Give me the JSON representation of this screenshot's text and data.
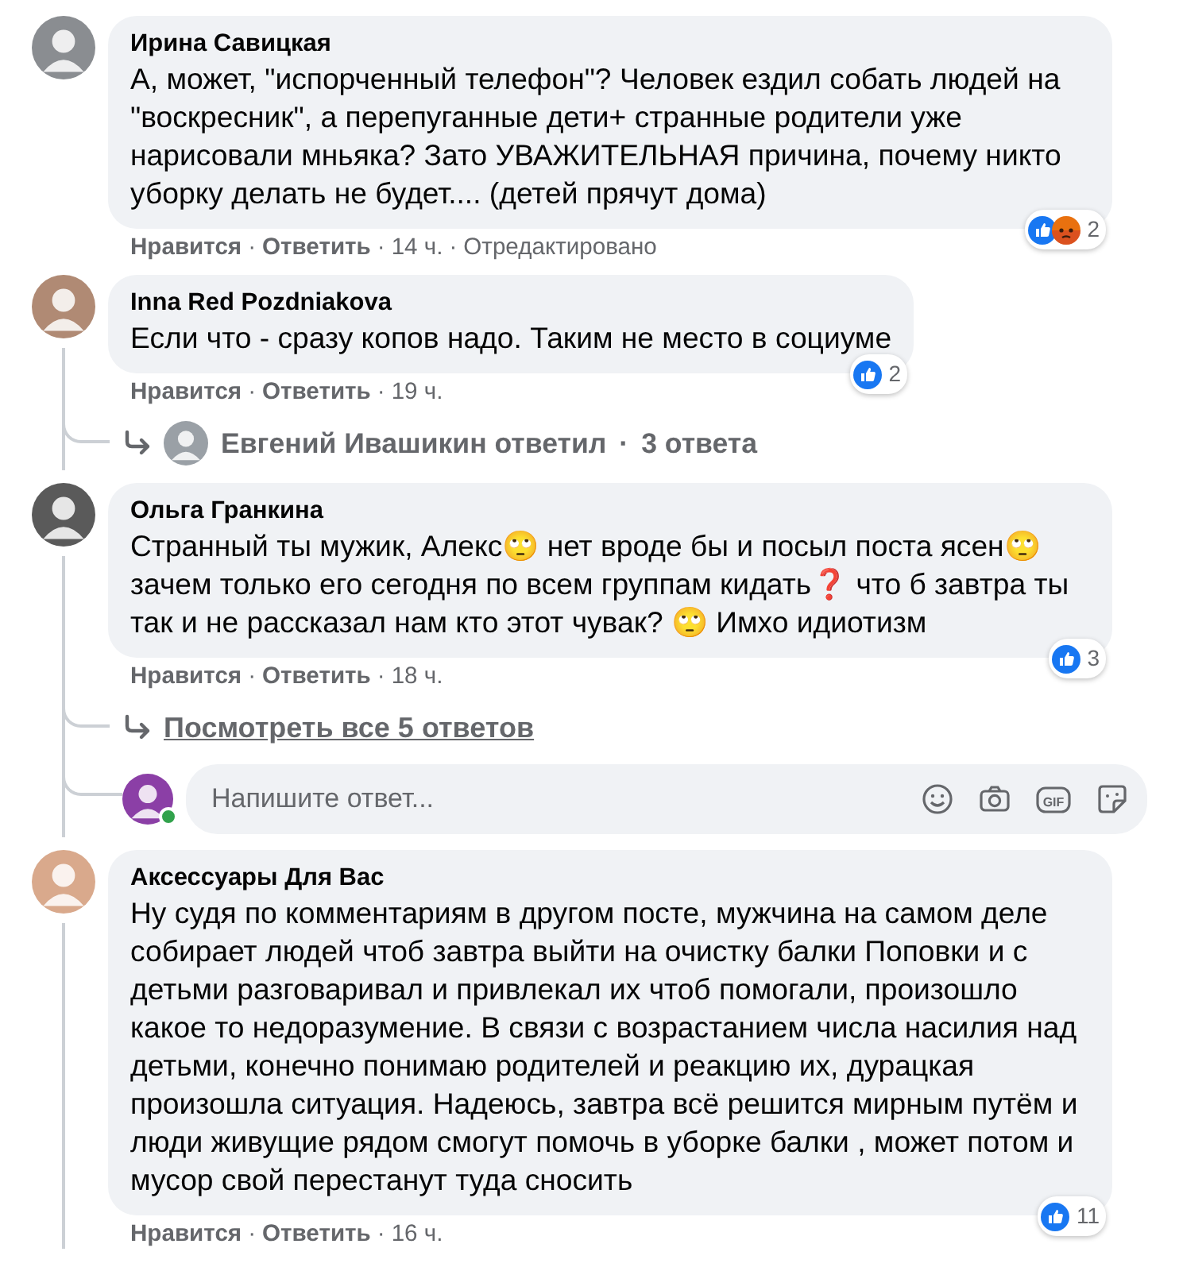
{
  "separator": "·",
  "comments": [
    {
      "author": "Ирина Савицкая",
      "text": "А, может, \"испорченный телефон\"? Человек ездил собать людей на \"воскресник\", а перепуганные дети+ странные родители уже нарисовали мньяка? Зато УВАЖИТЕЛЬНАЯ причина, почему никто уборку делать не будет.... (детей прячут дома)",
      "reactions": {
        "icons": [
          {
            "kind": "like"
          },
          {
            "kind": "angry"
          }
        ],
        "count": "2"
      },
      "actions": [
        "Нравится",
        "Ответить"
      ],
      "time": "14 ч.",
      "edited": "Отредактировано",
      "thread": false
    },
    {
      "author": "Inna Red Pozdniakova",
      "text": "Если что - сразу копов надо. Таким не место в социуме",
      "reactions": {
        "icons": [
          {
            "kind": "like"
          }
        ],
        "count": "2"
      },
      "actions": [
        "Нравится",
        "Ответить"
      ],
      "time": "19 ч.",
      "thread": true,
      "replies": [
        {
          "kind": "summary",
          "author": "Евгений Ивашикин ответил",
          "count": "3 ответа"
        }
      ]
    },
    {
      "author": "Ольга Гранкина",
      "text": "Странный ты мужик, Алекс🙄 нет вроде бы и посыл поста ясен🙄 зачем только его сегодня по всем группам кидать❓ что б завтра ты так и не рассказал нам кто этот чувак? 🙄 Имхо идиотизм",
      "reactions": {
        "icons": [
          {
            "kind": "like"
          }
        ],
        "count": "3"
      },
      "actions": [
        "Нравится",
        "Ответить"
      ],
      "time": "18 ч.",
      "thread": true,
      "replies": [
        {
          "kind": "view_all",
          "text": "Посмотреть все 5 ответов"
        },
        {
          "kind": "composer",
          "placeholder": "Напишите ответ...",
          "online": true,
          "gif_label": "GIF"
        }
      ]
    },
    {
      "author": "Аксессуары Для Вас",
      "text": "Ну судя по комментариям в другом посте, мужчина на самом деле собирает людей чтоб завтра выйти на очистку балки Поповки и с детьми разговаривал и привлекал их чтоб помогали, произошло какое то недоразумение. В связи с возрастанием числа насилия над детьми, конечно понимаю родителей и реакцию их, дурацкая произошла ситуация. Надеюсь, завтра всё решится мирным путём и люди живущие рядом смогут помочь в уборке балки , может потом и мусор свой перестанут туда сносить",
      "reactions": {
        "icons": [
          {
            "kind": "like"
          }
        ],
        "count": "11"
      },
      "actions": [
        "Нравится",
        "Ответить"
      ],
      "time": "16 ч.",
      "thread": true
    }
  ]
}
